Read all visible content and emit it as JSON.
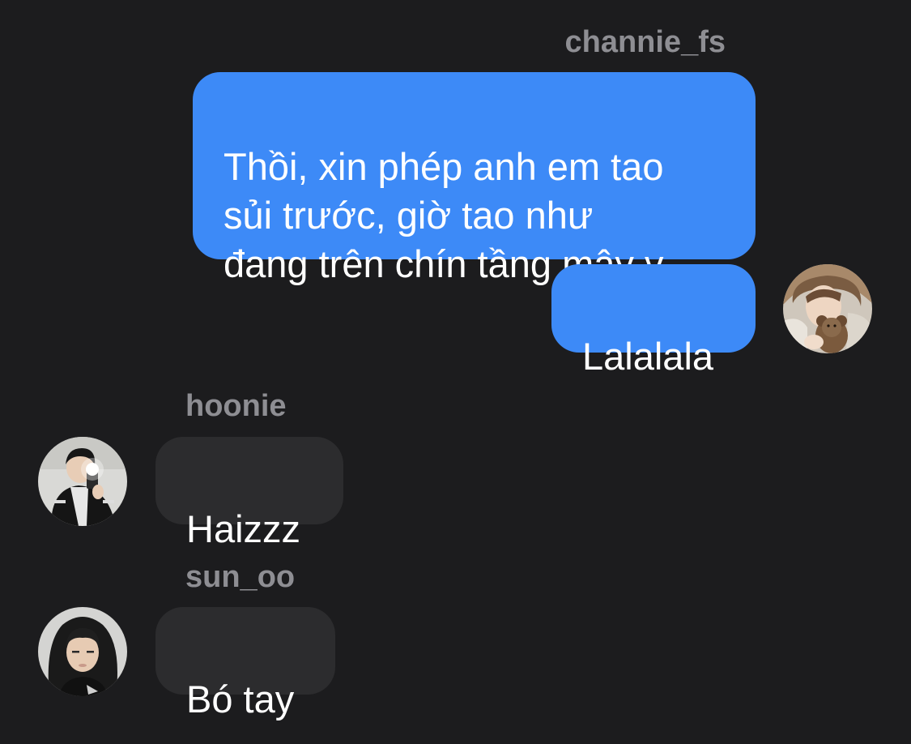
{
  "messages": {
    "outgoing": {
      "sender": "channie_fs",
      "bubble_1": "Thồi, xin phép anh em tao\nsủi trước, giờ tao như\nđang trên chín tầng mây v",
      "bubble_2": "Lalalala"
    },
    "hoonie": {
      "sender": "hoonie",
      "text": "Haizzz"
    },
    "sun_oo": {
      "sender": "sun_oo",
      "text": "Bó tay"
    }
  },
  "colors": {
    "background": "#1c1c1e",
    "outgoing_bubble": "#3d8af7",
    "incoming_bubble": "#2c2c2e",
    "sender_name": "#8e8e93",
    "message_text": "#ffffff"
  },
  "icons": {
    "avatar_channie": "avatar-photo",
    "avatar_hoonie": "avatar-photo",
    "avatar_sun_oo": "avatar-photo"
  }
}
